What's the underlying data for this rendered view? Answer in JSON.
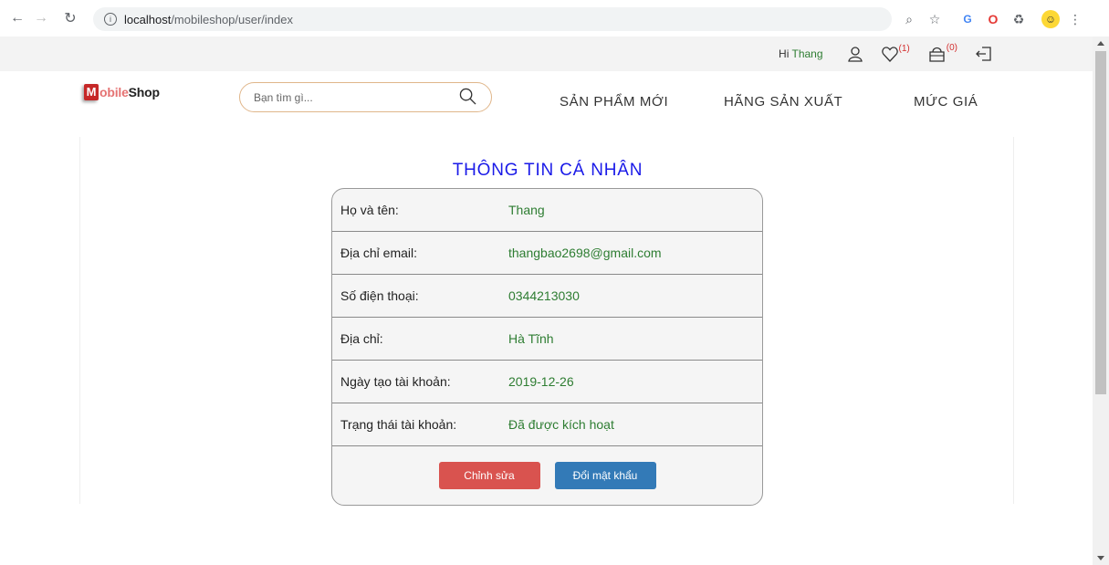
{
  "browser": {
    "url_host": "localhost",
    "url_path": "/mobileshop/user/index"
  },
  "topbar": {
    "greeting": "Hi",
    "username": "Thang",
    "wishlist_count": "(1)",
    "cart_count": "(0)"
  },
  "header": {
    "logo_mark": "M",
    "logo_colored": "obile",
    "logo_dark": "Shop",
    "search_placeholder": "Bạn tìm gì...",
    "menu": [
      "SẢN PHẨM MỚI",
      "HÃNG SẢN XUẤT",
      "MỨC GIÁ"
    ]
  },
  "profile": {
    "title": "THÔNG TIN CÁ NHÂN",
    "rows": [
      {
        "label": "Họ và tên:",
        "value": "Thang"
      },
      {
        "label": "Địa chỉ email:",
        "value": "thangbao2698@gmail.com"
      },
      {
        "label": "Số điện thoại:",
        "value": "0344213030"
      },
      {
        "label": "Địa chỉ:",
        "value": "Hà Tĩnh"
      },
      {
        "label": "Ngày tạo tài khoản:",
        "value": "2019-12-26"
      },
      {
        "label": "Trạng thái tài khoản:",
        "value": "Đã được kích hoạt"
      }
    ],
    "edit_label": "Chỉnh sửa",
    "change_password_label": "Đổi mật khẩu"
  },
  "colors": {
    "title": "#1a1ae8",
    "value_green": "#2e7d32",
    "edit_button": "#d9534f",
    "password_button": "#337ab7"
  }
}
